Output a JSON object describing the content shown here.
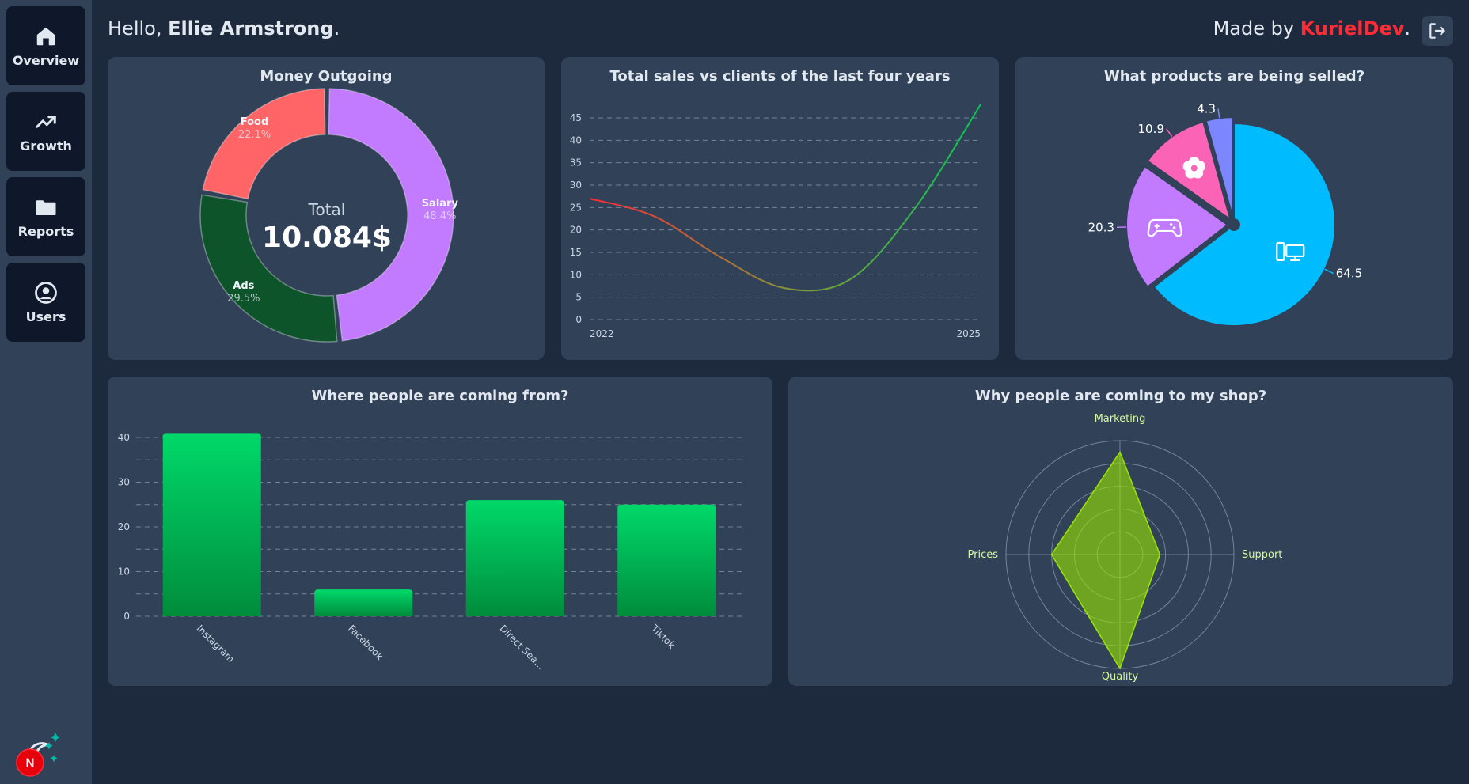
{
  "sidebar": {
    "items": [
      {
        "label": "Overview",
        "icon": "home-icon"
      },
      {
        "label": "Growth",
        "icon": "trending-up-icon"
      },
      {
        "label": "Reports",
        "icon": "folder-icon"
      },
      {
        "label": "Users",
        "icon": "user-circle-icon"
      }
    ],
    "avatar_letter": "N"
  },
  "header": {
    "greeting_prefix": "Hello, ",
    "user_name": "Ellie Armstrong",
    "greeting_suffix": ".",
    "madeby_prefix": "Made by ",
    "author": "KurielDev",
    "madeby_suffix": "."
  },
  "colors": {
    "page_bg": "#1d293d",
    "card_bg": "#314158",
    "nav_bg": "#0f172b",
    "accent_red": "#fb2c36",
    "green": "#00c950"
  },
  "chart_data": [
    {
      "type": "pie",
      "variant": "donut",
      "title": "Money Outgoing",
      "center_label": "Total",
      "center_value": "10.084$",
      "slices": [
        {
          "name": "Salary",
          "value": 48.4,
          "label": "48.4%",
          "color": "#c27aff"
        },
        {
          "name": "Ads",
          "value": 29.5,
          "label": "29.5%",
          "color": "#0d542b"
        },
        {
          "name": "Food",
          "value": 22.1,
          "label": "22.1%",
          "color": "#ff6467"
        }
      ]
    },
    {
      "type": "line",
      "title": "Total sales vs clients of the last four years",
      "x_labels": [
        "2022",
        "2025"
      ],
      "x": [
        2022,
        2022.5,
        2023,
        2023.5,
        2024,
        2024.5,
        2025
      ],
      "values": [
        27,
        23,
        14,
        7,
        9,
        25,
        48
      ],
      "ylim": [
        0,
        48
      ],
      "yticks": [
        0,
        5,
        10,
        15,
        20,
        25,
        30,
        35,
        40,
        45
      ],
      "grid": true,
      "gradient": [
        "#fb2c36",
        "#00c950"
      ]
    },
    {
      "type": "pie",
      "title": "What products are being selled?",
      "slices": [
        {
          "value": 64.5,
          "label": "64.5",
          "color": "#00bcff",
          "icon": "computer-icon"
        },
        {
          "value": 20.3,
          "label": "20.3",
          "color": "#c27aff",
          "icon": "gamepad-icon"
        },
        {
          "value": 10.9,
          "label": "10.9",
          "color": "#fb64b6",
          "icon": "flower-icon"
        },
        {
          "value": 4.3,
          "label": "4.3",
          "color": "#7c86ff",
          "icon": ""
        }
      ]
    },
    {
      "type": "bar",
      "title": "Where people are coming from?",
      "categories": [
        "Instagram",
        "Facebook",
        "Direct Sea...",
        "Tiktok"
      ],
      "values": [
        41,
        6,
        26,
        25
      ],
      "ylim": [
        0,
        40
      ],
      "yticks": [
        0,
        10,
        20,
        30,
        40
      ],
      "grid": true
    },
    {
      "type": "radar",
      "title": "Why people are coming to my shop?",
      "axes": [
        "Marketing",
        "Support",
        "Quality",
        "Prices"
      ],
      "values": [
        90,
        35,
        100,
        60
      ],
      "max": 100,
      "rings": 5,
      "color": "#9ae600"
    }
  ]
}
